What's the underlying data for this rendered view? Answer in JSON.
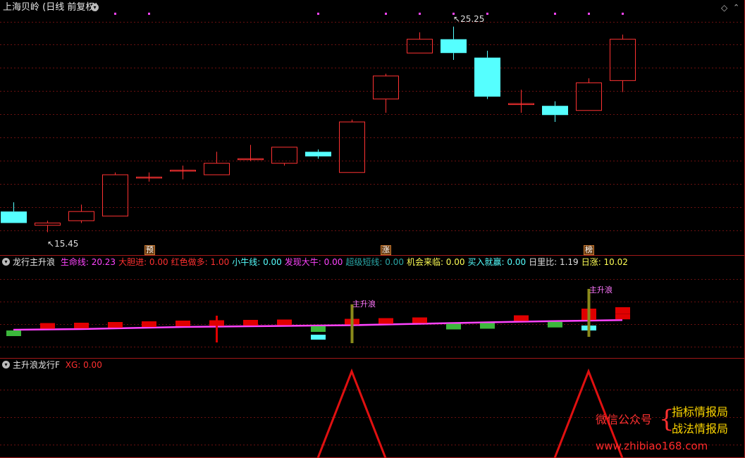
{
  "header": {
    "title": "上海贝岭 (日线 前复权)",
    "diamond_icon": "diamond-icon",
    "menu_icon": "chevron-down-icon"
  },
  "main_chart": {
    "high_label": "25.25",
    "low_label": "15.45",
    "signals": [
      "预",
      "涨",
      "榜"
    ]
  },
  "indicator1": {
    "name": "龙行主升浪",
    "items": [
      {
        "label": "生命线: ",
        "value": "20.23",
        "color": "#ff44ff"
      },
      {
        "label": "大胆进: ",
        "value": "0.00",
        "color": "#ff3030"
      },
      {
        "label": "红色做多: ",
        "value": "1.00",
        "color": "#ff3030"
      },
      {
        "label": "小牛线: ",
        "value": "0.00",
        "color": "#55ffff"
      },
      {
        "label": "发现大牛: ",
        "value": "0.00",
        "color": "#ff44ff"
      },
      {
        "label": "超级短线: ",
        "value": "0.00",
        "color": "#2aa7a7"
      },
      {
        "label": "机会来临: ",
        "value": "0.00",
        "color": "#ffff55"
      },
      {
        "label": "买入就赢: ",
        "value": "0.00",
        "color": "#55ffff"
      },
      {
        "label": "日里比: ",
        "value": "1.19",
        "color": "#e0e0e0"
      },
      {
        "label": "日涨: ",
        "value": "10.02",
        "color": "#ffff55"
      }
    ],
    "annotation": "主升浪"
  },
  "indicator2": {
    "name": "主升浪龙行F",
    "xg_label": "XG: 0.00"
  },
  "watermark": {
    "line1_left": "微信公众号",
    "line1_right": "指标情报局",
    "line2_right": "战法情报局",
    "url": "www.zhibiao168.com"
  },
  "chart_data": {
    "type": "candlestick",
    "candles": [
      {
        "o": 17.2,
        "h": 17.6,
        "l": 16.7,
        "c": 16.7
      },
      {
        "o": 16.6,
        "h": 16.8,
        "l": 16.3,
        "c": 16.7
      },
      {
        "o": 16.8,
        "h": 17.5,
        "l": 16.7,
        "c": 17.2
      },
      {
        "o": 17.0,
        "h": 18.9,
        "l": 17.0,
        "c": 18.8
      },
      {
        "o": 18.7,
        "h": 18.9,
        "l": 18.5,
        "c": 18.7
      },
      {
        "o": 19.0,
        "h": 19.2,
        "l": 18.6,
        "c": 19.0
      },
      {
        "o": 18.8,
        "h": 19.8,
        "l": 18.8,
        "c": 19.3
      },
      {
        "o": 19.5,
        "h": 20.1,
        "l": 19.4,
        "c": 19.5
      },
      {
        "o": 19.3,
        "h": 20.0,
        "l": 19.2,
        "c": 20.0
      },
      {
        "o": 19.8,
        "h": 19.9,
        "l": 19.5,
        "c": 19.6
      },
      {
        "o": 18.9,
        "h": 21.2,
        "l": 18.9,
        "c": 21.1
      },
      {
        "o": 22.1,
        "h": 23.2,
        "l": 21.5,
        "c": 23.1
      },
      {
        "o": 24.1,
        "h": 25.0,
        "l": 24.1,
        "c": 24.7
      },
      {
        "o": 24.7,
        "h": 25.25,
        "l": 23.8,
        "c": 24.1
      },
      {
        "o": 23.9,
        "h": 24.2,
        "l": 22.1,
        "c": 22.2
      },
      {
        "o": 21.9,
        "h": 22.5,
        "l": 21.5,
        "c": 21.9
      },
      {
        "o": 21.8,
        "h": 22.0,
        "l": 21.1,
        "c": 21.4
      },
      {
        "o": 21.6,
        "h": 23.0,
        "l": 21.6,
        "c": 22.8
      },
      {
        "o": 22.9,
        "h": 24.9,
        "l": 22.4,
        "c": 24.7
      }
    ],
    "lifeline": [
      18.85,
      18.9,
      18.95,
      19.05,
      19.15,
      19.25,
      19.3,
      19.35,
      19.4,
      19.45,
      19.5,
      19.6,
      19.7,
      19.8,
      19.9,
      20.0,
      20.08,
      20.15,
      20.23
    ]
  }
}
